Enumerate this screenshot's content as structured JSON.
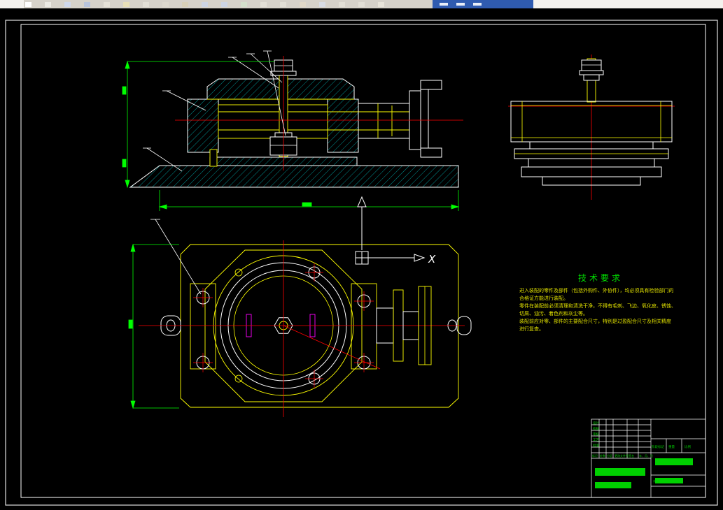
{
  "toolbar": {
    "icon_names": [
      "app-logo-icon",
      "new-icon",
      "open-icon",
      "save-icon",
      "print-icon",
      "preview-icon",
      "cut-icon",
      "copy-icon",
      "paste-icon",
      "undo-icon",
      "redo-icon",
      "layer-icon",
      "line-icon",
      "circle-icon",
      "dim-icon",
      "zoom-icon",
      "pan-icon",
      "grid-icon",
      "help-icon"
    ]
  },
  "drawing": {
    "axis_label": "X",
    "tech": {
      "title": "技术要求",
      "lines": [
        "进入装配的零件及部件（包括外购件、外协件），均必须具有检验部门的",
        "合格证方能进行装配。",
        "零件在装配前必须清理和清洗干净，不得有毛刺、飞边、氧化皮、锈蚀、",
        "切屑、油污、着色剂和灰尘等。",
        "装配前应对零、部件的主要配合尺寸，特别是过盈配合尺寸及相关精度",
        "进行复查。"
      ]
    },
    "title_block": {
      "change_headers": [
        "标记",
        "处数",
        "分区",
        "更改文件号",
        "签名",
        "年、月、日"
      ],
      "sign_rows": [
        "设计",
        "校核",
        "审核",
        "工艺",
        "批准"
      ],
      "right_labels": [
        "阶段标记",
        "重量",
        "比例"
      ],
      "sheet_label": "共 张 第 张"
    }
  },
  "colors": {
    "geometry": "#ffffff",
    "auxiliary": "#ffff00",
    "centerline": "#ff0000",
    "dimension": "#00ff00",
    "hatch": "#00b4b4",
    "highlight": "#ff00ff",
    "text_green": "#00d000",
    "toolbar_blue": "#2f5bb0"
  }
}
